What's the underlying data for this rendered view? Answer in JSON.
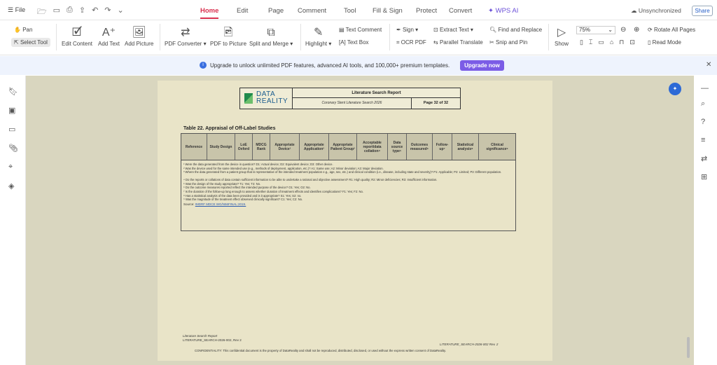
{
  "topbar": {
    "file_label": "File",
    "menu_tabs": [
      "Home",
      "Edit",
      "Page",
      "Comment",
      "Tool",
      "Fill & Sign",
      "Protect",
      "Convert",
      "WPS AI"
    ],
    "active_tab": "Home",
    "sync_status": "Unsynchronized",
    "share_label": "Share"
  },
  "ribbon": {
    "pan": "Pan",
    "select_tool": "Select Tool",
    "edit_content": "Edit Content",
    "add_text": "Add Text",
    "add_picture": "Add Picture",
    "pdf_converter": "PDF Converter",
    "pdf_to_picture": "PDF to Picture",
    "split_merge": "Split and Merge",
    "highlight": "Highlight",
    "text_comment": "Text Comment",
    "text_box": "Text Box",
    "sign": "Sign",
    "ocr_pdf": "OCR PDF",
    "extract_text": "Extract Text",
    "parallel_translate": "Parallel Translate",
    "find_replace": "Find and Replace",
    "snip_pin": "Snip and Pin",
    "show": "Show",
    "zoom": "75%",
    "rotate_all": "Rotate All Pages",
    "read_mode": "Read Mode",
    "accent_color": "#d9304f"
  },
  "banner": {
    "message": "Upgrade to unlock unlimited PDF features, advanced AI tools, and 100,000+ premium templates.",
    "button": "Upgrade now",
    "button_color": "#7b5ce6"
  },
  "document": {
    "logo_line1": "DATA",
    "logo_line2": "REALITY",
    "report_title": "Literature Search Report",
    "report_subtitle": "Coronary Stent Literature Search 2026",
    "page_label": "Page 32 of 32",
    "table_title": "Table 22. Appraisal of Off-Label Studies",
    "columns": [
      "Reference",
      "Study Design",
      "LoE Oxford",
      "MDCG Rank",
      "Appropriate Device¹",
      "Appropriate Application²",
      "Appropriate Patient Group³",
      "Acceptable report/data collation⁴",
      "Data source type⁵",
      "Outcomes measured⁶",
      "Follow-up⁷",
      "Statistical analysis⁸",
      "Clinical significance⁹"
    ],
    "footnotes": [
      "¹ Were the data generated from the device in question? D1: Actual device; D2: Equivalent device; D3: Other device.",
      "² Was the device used for the same intended use (e.g., methods of deployment, application, etc.)? A1: Same use; A2: Minor deviation; A3: Major deviation.",
      "³ Where the data generated from a patient group that is representative of the intended treatment population e.g., age, sex, etc.) and clinical condition (i.e., disease, including state and severity)? P1: Applicable; P2: Limited; P3: Different population.",
      "⁴ Do the reports or collations of data contain sufficient information to be able to undertake a rational and objective assessment? R1: High quality; R2: Minor deficiencies; R3: Insufficient information.",
      "⁵ Was the design of the study appropriate? T1: Yes; T2: No.",
      "⁶ Do the outcome measures reported reflect the intended purpose of the device? O1: Yes; O2: No.",
      "⁷ Is the duration of the follow-up long enough to assess whether duration of treatment effects and identifies complications? F1: Yes; F2: No.",
      "⁸ Has a statistical analysis of the data been provided and is it appropriate? S1: Yes; S2: no.",
      "⁹ Was the magnitude of the treatment effect observed clinically significant? C1: Yes; C2: No."
    ],
    "source_label": "Source:",
    "source_link": "IMDRF MDCE WG/N56FINAL:2019.",
    "footer_line1": "Literature Search Report",
    "footer_line2": "LITERATURE_SEARCH-2026-002, Rev 2",
    "footer_right": "LITERATURE_SEARCH-2026-002 Rev. 2",
    "confidentiality": "CONFIDENTIALITY: This confidential document is the property of DataReality and shall not be reproduced, distributed, disclosed, or used without the express written consent of DataReality."
  }
}
